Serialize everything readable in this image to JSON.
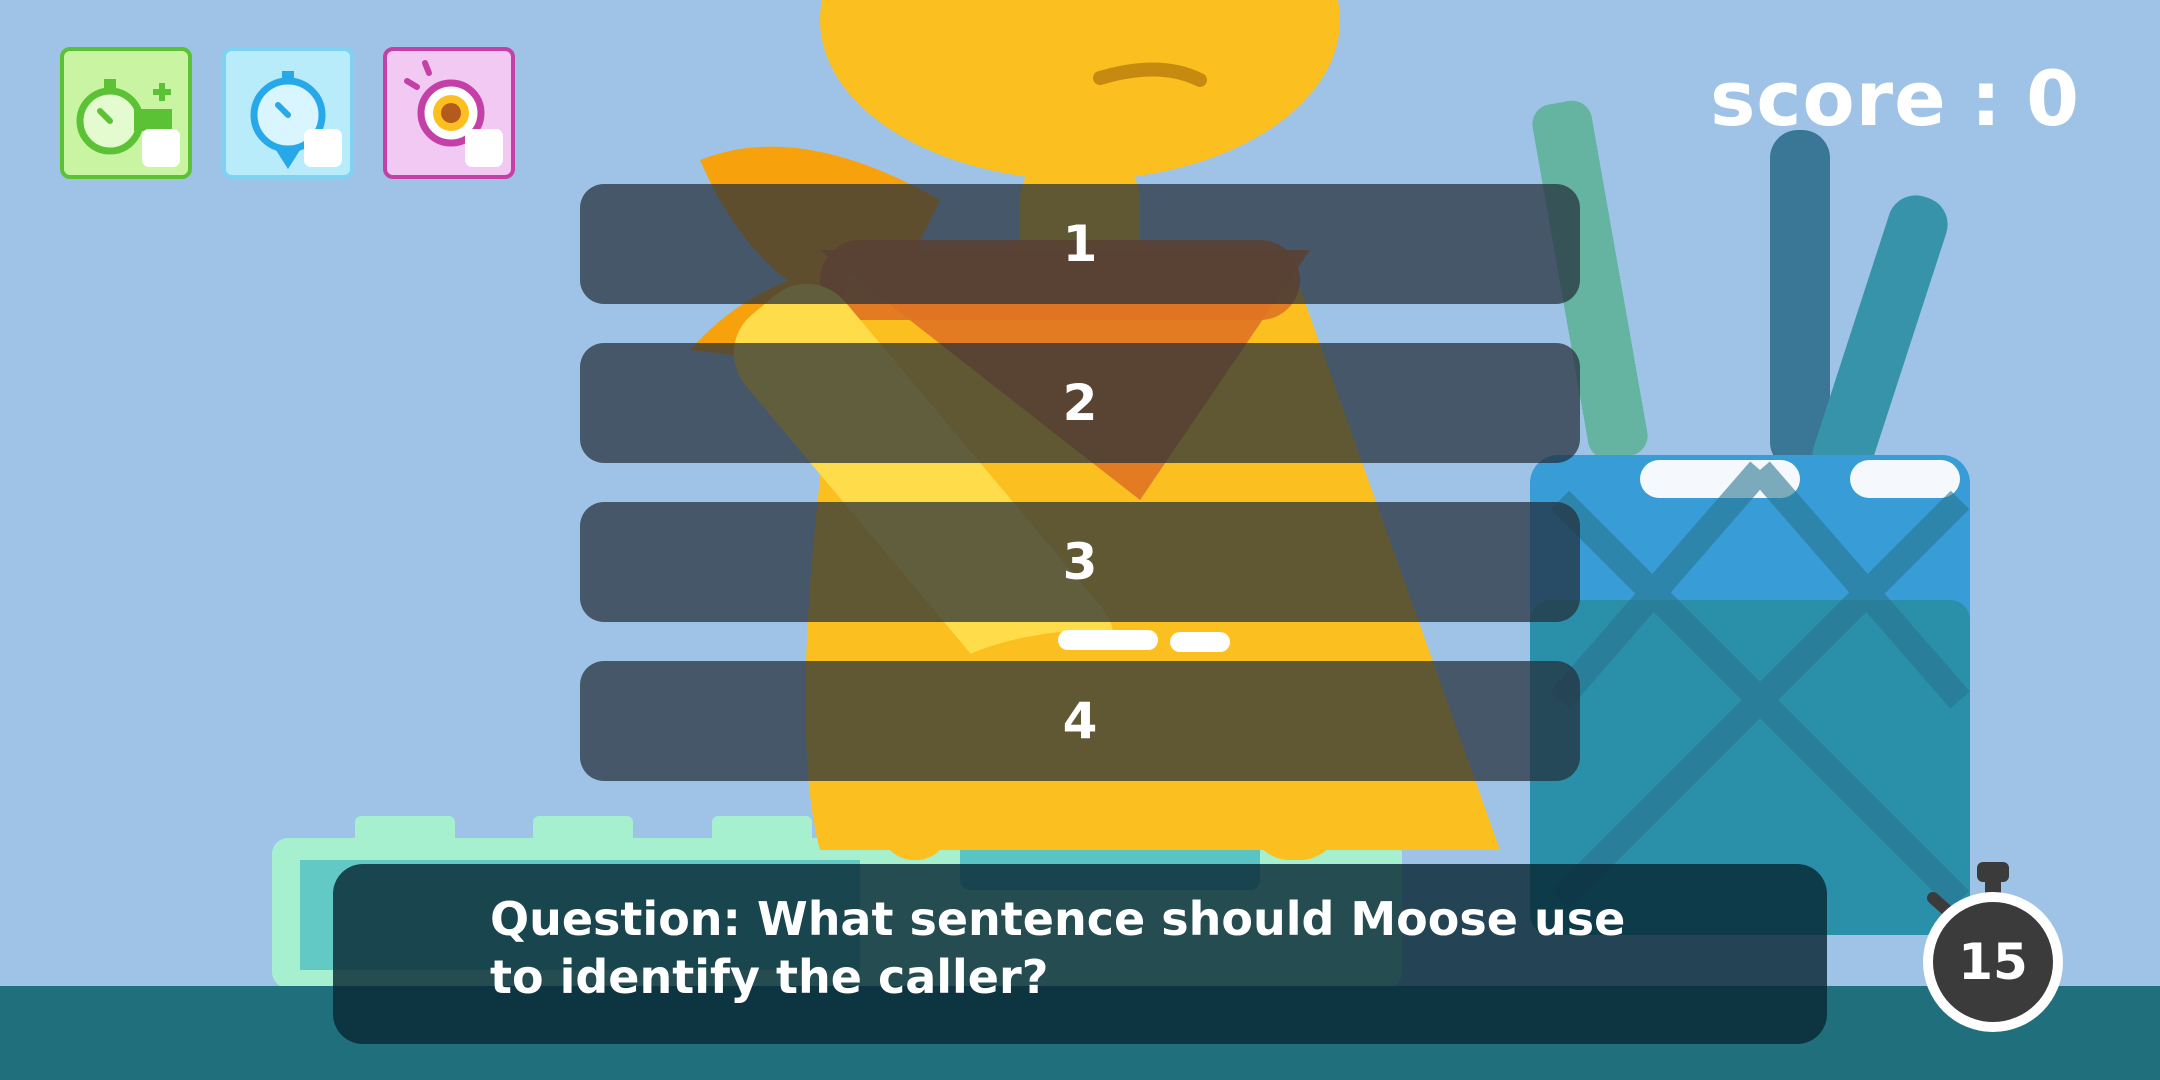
{
  "hud": {
    "score_label": "score",
    "score_sep": ":",
    "score_value": "0",
    "timer_value": "15"
  },
  "powerups": [
    {
      "name": "time-bonus",
      "color": "#5cc235",
      "bg": "#c9f5a3"
    },
    {
      "name": "time-freeze",
      "color": "#27a8e8",
      "bg": "#b9ecfb"
    },
    {
      "name": "focus",
      "color": "#c43fa6",
      "bg": "#f1c9f3"
    }
  ],
  "answers": [
    {
      "label": "1"
    },
    {
      "label": "2"
    },
    {
      "label": "3"
    },
    {
      "label": "4"
    }
  ],
  "question": {
    "text": "Question: What sentence should Moose use to identify the caller?"
  },
  "colors": {
    "background": "#9fc3e6",
    "floor": "#1f6f7c",
    "character": "#fbc020",
    "answer_bg": "#2a3340",
    "question_bg": "#082834"
  }
}
